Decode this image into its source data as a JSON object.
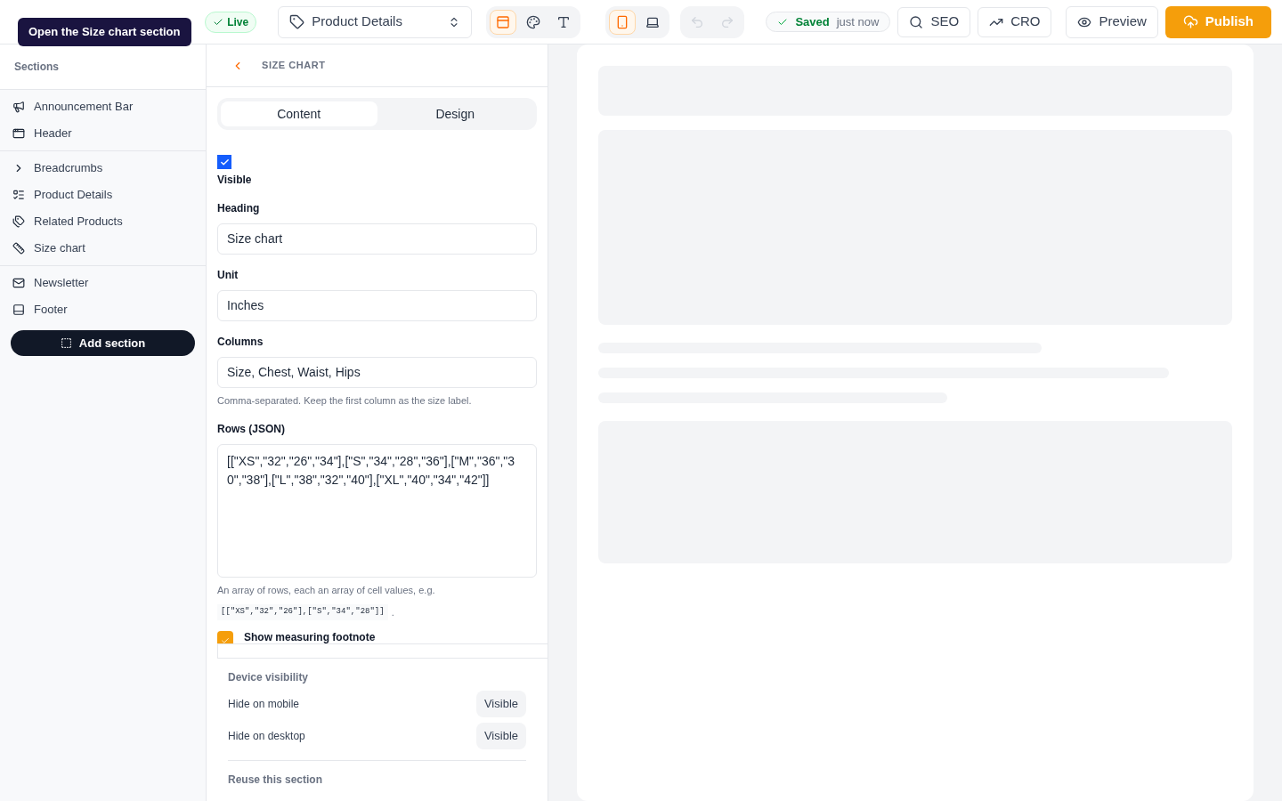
{
  "tooltip": "Open the Size chart section",
  "status_badge": {
    "label": "Live",
    "live": true
  },
  "page_select": {
    "value": "Product Details"
  },
  "view_modes": [
    {
      "kind": "layout",
      "selected": true
    },
    {
      "kind": "palette",
      "selected": false
    },
    {
      "kind": "type",
      "selected": false
    }
  ],
  "devices": [
    {
      "kind": "mobile",
      "selected": true
    },
    {
      "kind": "desktop",
      "selected": false
    }
  ],
  "history": [
    {
      "kind": "undo",
      "disabled": true
    },
    {
      "kind": "redo",
      "disabled": true
    }
  ],
  "save_status": {
    "label": "Saved",
    "time": "just now"
  },
  "tools": [
    {
      "kind": "search",
      "label": "SEO"
    },
    {
      "kind": "trend",
      "label": "CRO"
    }
  ],
  "preview_button": "Preview",
  "publish_button": "Publish",
  "sidebar": {
    "title": "Sections",
    "groups": [
      [
        {
          "label": "Announcement Bar"
        },
        {
          "label": "Header"
        }
      ],
      [
        {
          "label": "Breadcrumbs"
        },
        {
          "label": "Product Details"
        },
        {
          "label": "Related Products"
        },
        {
          "label": "Size chart"
        }
      ],
      [
        {
          "label": "Newsletter"
        },
        {
          "label": "Footer"
        }
      ]
    ],
    "add_button": "Add section"
  },
  "panel": {
    "title": "SIZE CHART",
    "tabs": [
      {
        "label": "Content",
        "selected": true
      },
      {
        "label": "Design",
        "selected": false
      }
    ],
    "visible": {
      "label": "Visible",
      "checked": true
    },
    "fields": [
      {
        "kind": "input",
        "label": "Heading",
        "value": "Size chart"
      },
      {
        "kind": "input",
        "label": "Unit",
        "value": "Inches"
      },
      {
        "kind": "input",
        "label": "Columns",
        "value": "Size, Chest, Waist, Hips",
        "help": "Comma-separated. Keep the first column as the size label."
      },
      {
        "kind": "textarea",
        "label": "Rows (JSON)",
        "value": "[[\"XS\",\"32\",\"26\",\"34\"],[\"S\",\"34\",\"28\",\"36\"],[\"M\",\"36\",\"30\",\"38\"],[\"L\",\"38\",\"32\",\"40\"],[\"XL\",\"40\",\"34\",\"42\"]]",
        "help": "An array of rows, each an array of cell values, e.g.",
        "example": "[[\"XS\",\"32\",\"26\"],[\"S\",\"34\",\"28\"]]",
        "example_suffix": "."
      }
    ],
    "footnote": {
      "label": "Show measuring footnote",
      "checked": true
    },
    "device_visibility": {
      "title": "Device visibility",
      "rows": [
        {
          "label": "Hide on mobile",
          "value": "Visible"
        },
        {
          "label": "Hide on desktop",
          "value": "Visible"
        }
      ]
    },
    "reuse_title": "Reuse this section"
  }
}
